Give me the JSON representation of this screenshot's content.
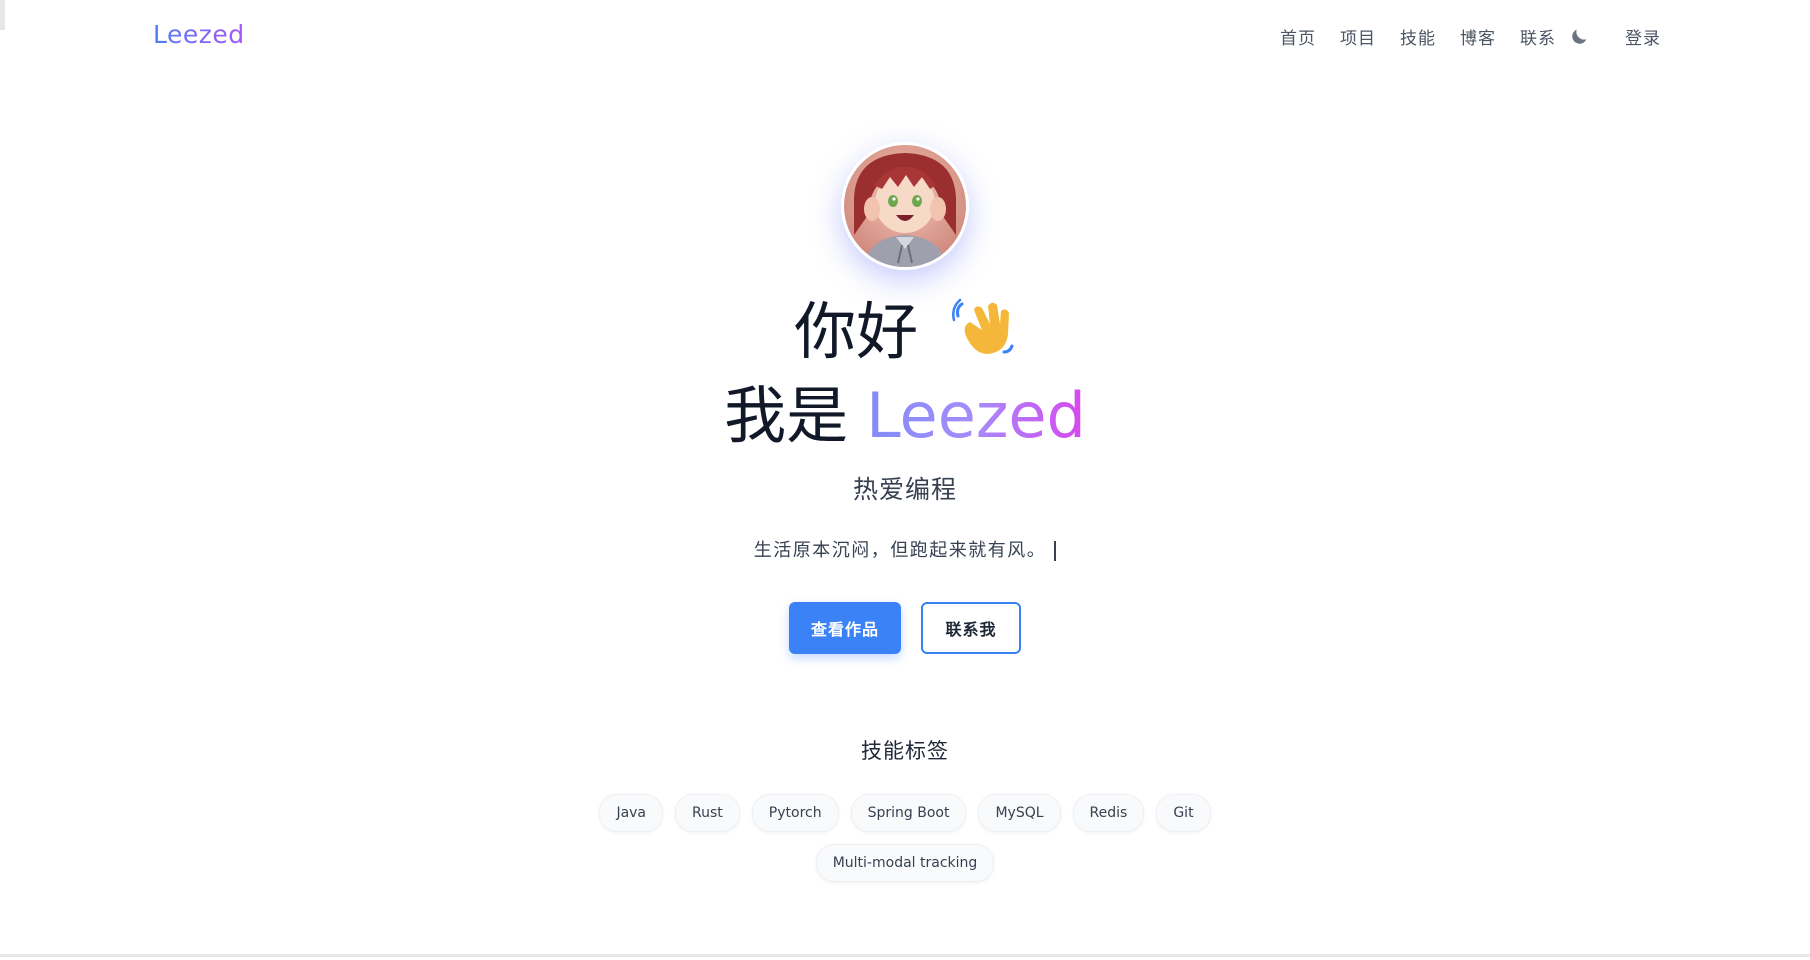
{
  "nav": {
    "logo": "Leezed",
    "links": [
      "首页",
      "项目",
      "技能",
      "博客",
      "联系"
    ],
    "theme_icon": "moon-icon",
    "login": "登录"
  },
  "hero": {
    "greeting": "你好",
    "wave_icon": "waving-hand-icon",
    "intro_prefix": "我是",
    "name": "Leezed",
    "tagline": "热爱编程",
    "motto": "生活原本沉闷，但跑起来就有风。"
  },
  "buttons": {
    "primary": "查看作品",
    "secondary": "联系我"
  },
  "skills": {
    "title": "技能标签",
    "tags_row1": [
      "Java",
      "Rust",
      "Pytorch",
      "Spring Boot",
      "MySQL",
      "Redis",
      "Git"
    ],
    "tags_row2": [
      "Multi-modal tracking"
    ]
  },
  "colors": {
    "primary": "#3b82f6",
    "gradient_start": "#818cf8",
    "gradient_end": "#d946ef"
  }
}
